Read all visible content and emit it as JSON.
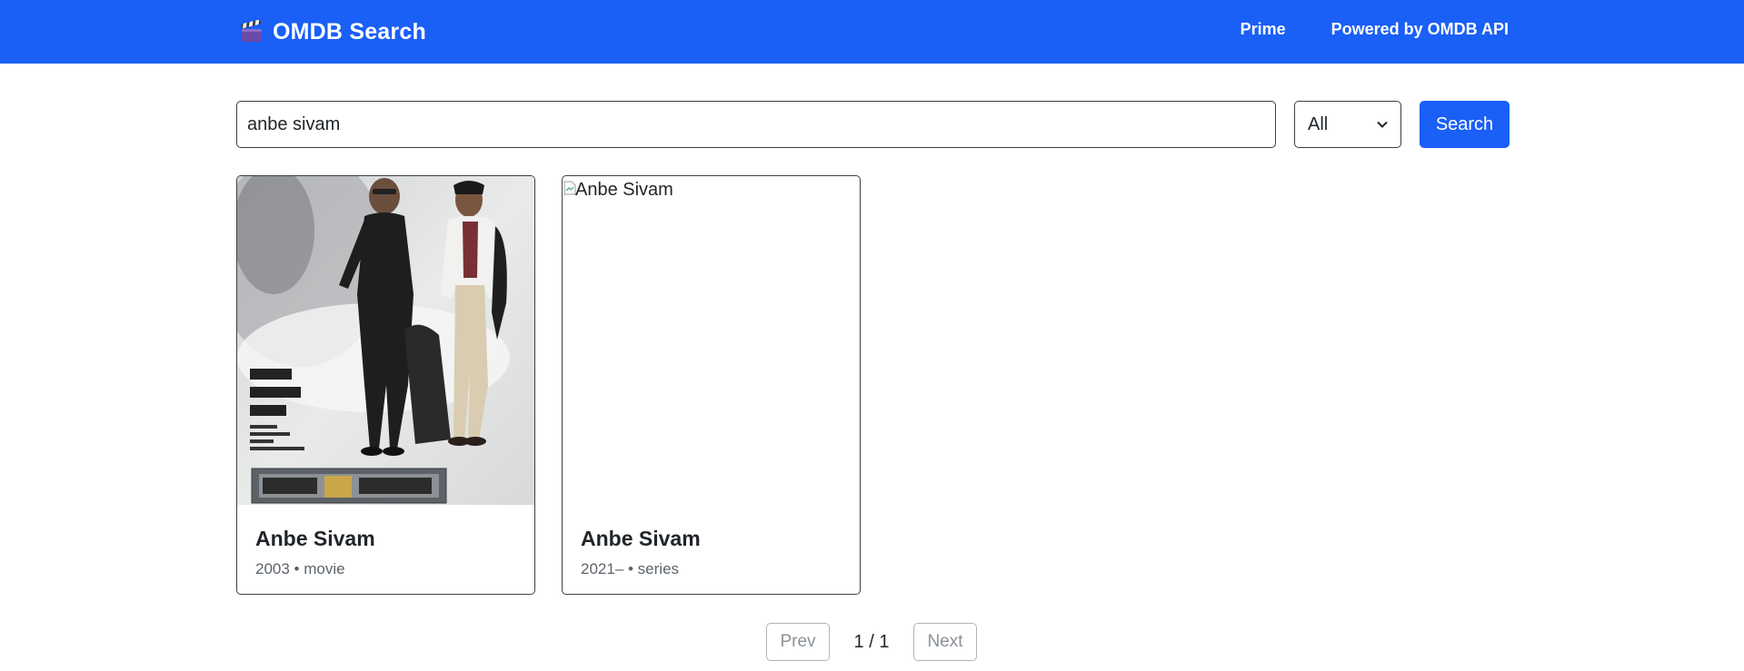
{
  "navbar": {
    "brand_icon": "clapperboard-icon",
    "brand_text": "OMDB Search",
    "links": [
      "Prime",
      "Powered by OMDB API"
    ],
    "color": "#1a5ff6"
  },
  "search": {
    "query": "anbe sivam",
    "type_selected": "All",
    "button_label": "Search"
  },
  "results": [
    {
      "title": "Anbe Sivam",
      "meta": "2003 • movie",
      "poster_alt": "Anbe Sivam",
      "poster_loaded": true
    },
    {
      "title": "Anbe Sivam",
      "meta": "2021– • series",
      "poster_alt": "Anbe Sivam",
      "poster_loaded": false
    }
  ],
  "pagination": {
    "prev_label": "Prev",
    "page_info": "1 / 1",
    "next_label": "Next"
  }
}
